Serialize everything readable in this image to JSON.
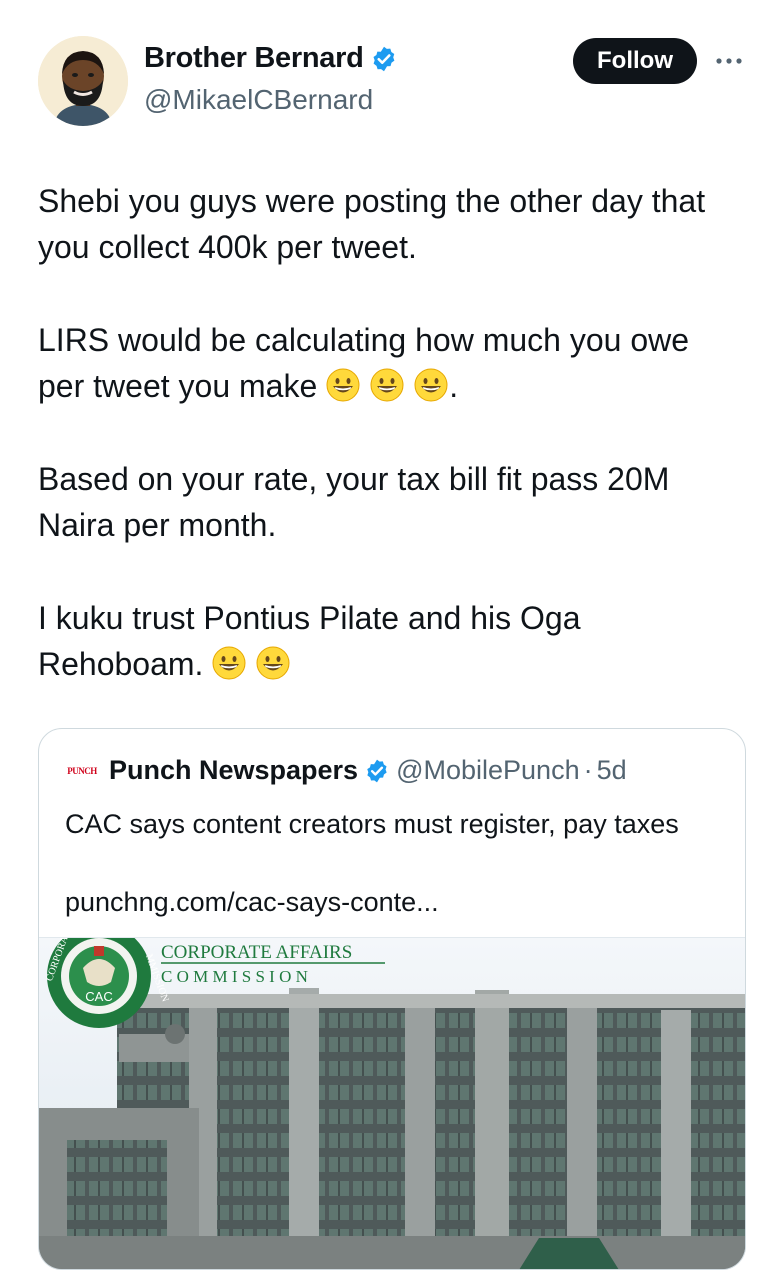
{
  "author": {
    "name": "Brother Bernard",
    "handle": "@MikaelCBernard",
    "verified": true,
    "avatar_icon": "bearded-man-avatar"
  },
  "actions": {
    "follow_label": "Follow",
    "more_icon": "more-horizontal-icon"
  },
  "tweet": {
    "paragraphs": [
      "Shebi you guys were posting the other day that you collect 400k per tweet.",
      "LIRS would be calculating how much you owe per tweet you make",
      ".",
      "Based on your rate, your tax bill fit pass 20M Naira per month.",
      "I kuku trust Pontius Pilate and his Oga Rehoboam."
    ],
    "emoji_icon": "grinning-face-emoji"
  },
  "quote": {
    "logo_text": "PUNCH",
    "name": "Punch Newspapers",
    "verified": true,
    "handle": "@MobilePunch",
    "separator": "·",
    "time": "5d",
    "text": "CAC says content creators must register, pay taxes",
    "link": "punchng.com/cac-says-conte...",
    "image": {
      "sign_line1": "CORPORATE AFFAIRS",
      "sign_line2": "C O M M I S S I O N",
      "seal_text": "CAC",
      "seal_ring_left": "CORPORA",
      "seal_ring_right": "MMISSION"
    }
  },
  "colors": {
    "text": "#0f1419",
    "secondary": "#536471",
    "verified_blue": "#1d9bf0",
    "button_bg": "#0f1419",
    "card_border": "#cfd9de"
  }
}
